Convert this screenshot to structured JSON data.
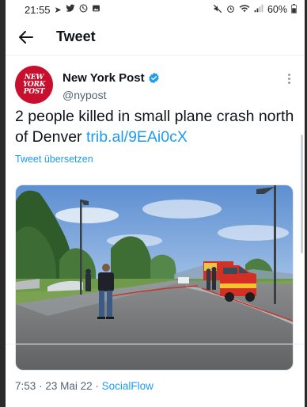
{
  "status_bar": {
    "time": "21:55",
    "battery": "60%",
    "left_icons": [
      "navigation-icon",
      "twitter-icon",
      "whatsapp-icon",
      "gallery-icon"
    ],
    "right_icons": [
      "mute-icon",
      "alarm-icon",
      "wifi-icon",
      "signal-icon",
      "battery-icon"
    ]
  },
  "header": {
    "title": "Tweet"
  },
  "tweet": {
    "author_name": "New York Post",
    "handle": "@nypost",
    "avatar_text": [
      "NEW",
      "YORK",
      "POST"
    ],
    "verified": true,
    "text": "2 people killed in small plane crash north of Denver ",
    "link": "trib.al/9EAi0cX",
    "translate_label": "Tweet übersetzen",
    "time": "7:53",
    "date": "23 Mai 22",
    "separator": "·",
    "source": "SocialFlow"
  },
  "colors": {
    "accent": "#1d9bf0",
    "avatar_bg": "#c8102e",
    "text": "#0f1419",
    "secondary": "#536471"
  }
}
